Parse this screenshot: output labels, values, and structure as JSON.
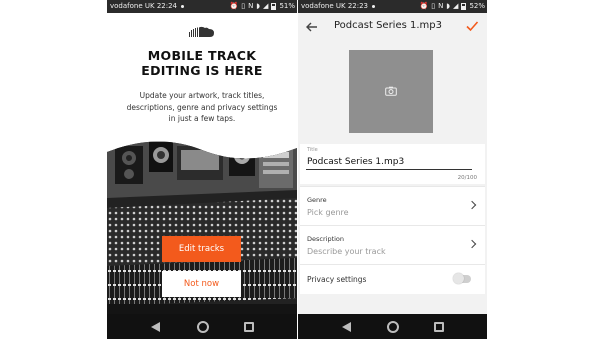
{
  "left_phone": {
    "status": {
      "carrier": "vodafone UK",
      "time": "22:24",
      "battery": "51%",
      "battery_level": 0.51
    },
    "headline_line1": "MOBILE TRACK",
    "headline_line2": "EDITING IS HERE",
    "subtext_line1": "Update your artwork, track titles,",
    "subtext_line2": "descriptions, genre and privacy settings",
    "subtext_line3": "in just a few taps.",
    "edit_button": "Edit tracks",
    "not_now_button": "Not now",
    "logo_icon": "soundcloud-cloud-icon",
    "image_subject": "recording-studio-mixing-console"
  },
  "right_phone": {
    "status": {
      "carrier": "vodafone UK",
      "time": "22:23",
      "battery": "52%",
      "battery_level": 0.52
    },
    "toolbar": {
      "title": "Podcast Series 1.mp3",
      "back_icon": "arrow-left-icon",
      "confirm_icon": "checkmark-icon"
    },
    "artwork_icon": "camera-icon",
    "title_field": {
      "label": "Title",
      "value": "Podcast Series 1.mp3",
      "counter": "20/100"
    },
    "genre": {
      "label": "Genre",
      "placeholder": "Pick genre"
    },
    "description": {
      "label": "Description",
      "placeholder": "Describe your track"
    },
    "privacy": {
      "label": "Privacy settings",
      "enabled": false
    }
  },
  "colors": {
    "accent": "#f35a1c",
    "status_bar": "#2b2b2b",
    "nav_bar": "#111111",
    "artwork_placeholder": "#8f8f8f"
  }
}
